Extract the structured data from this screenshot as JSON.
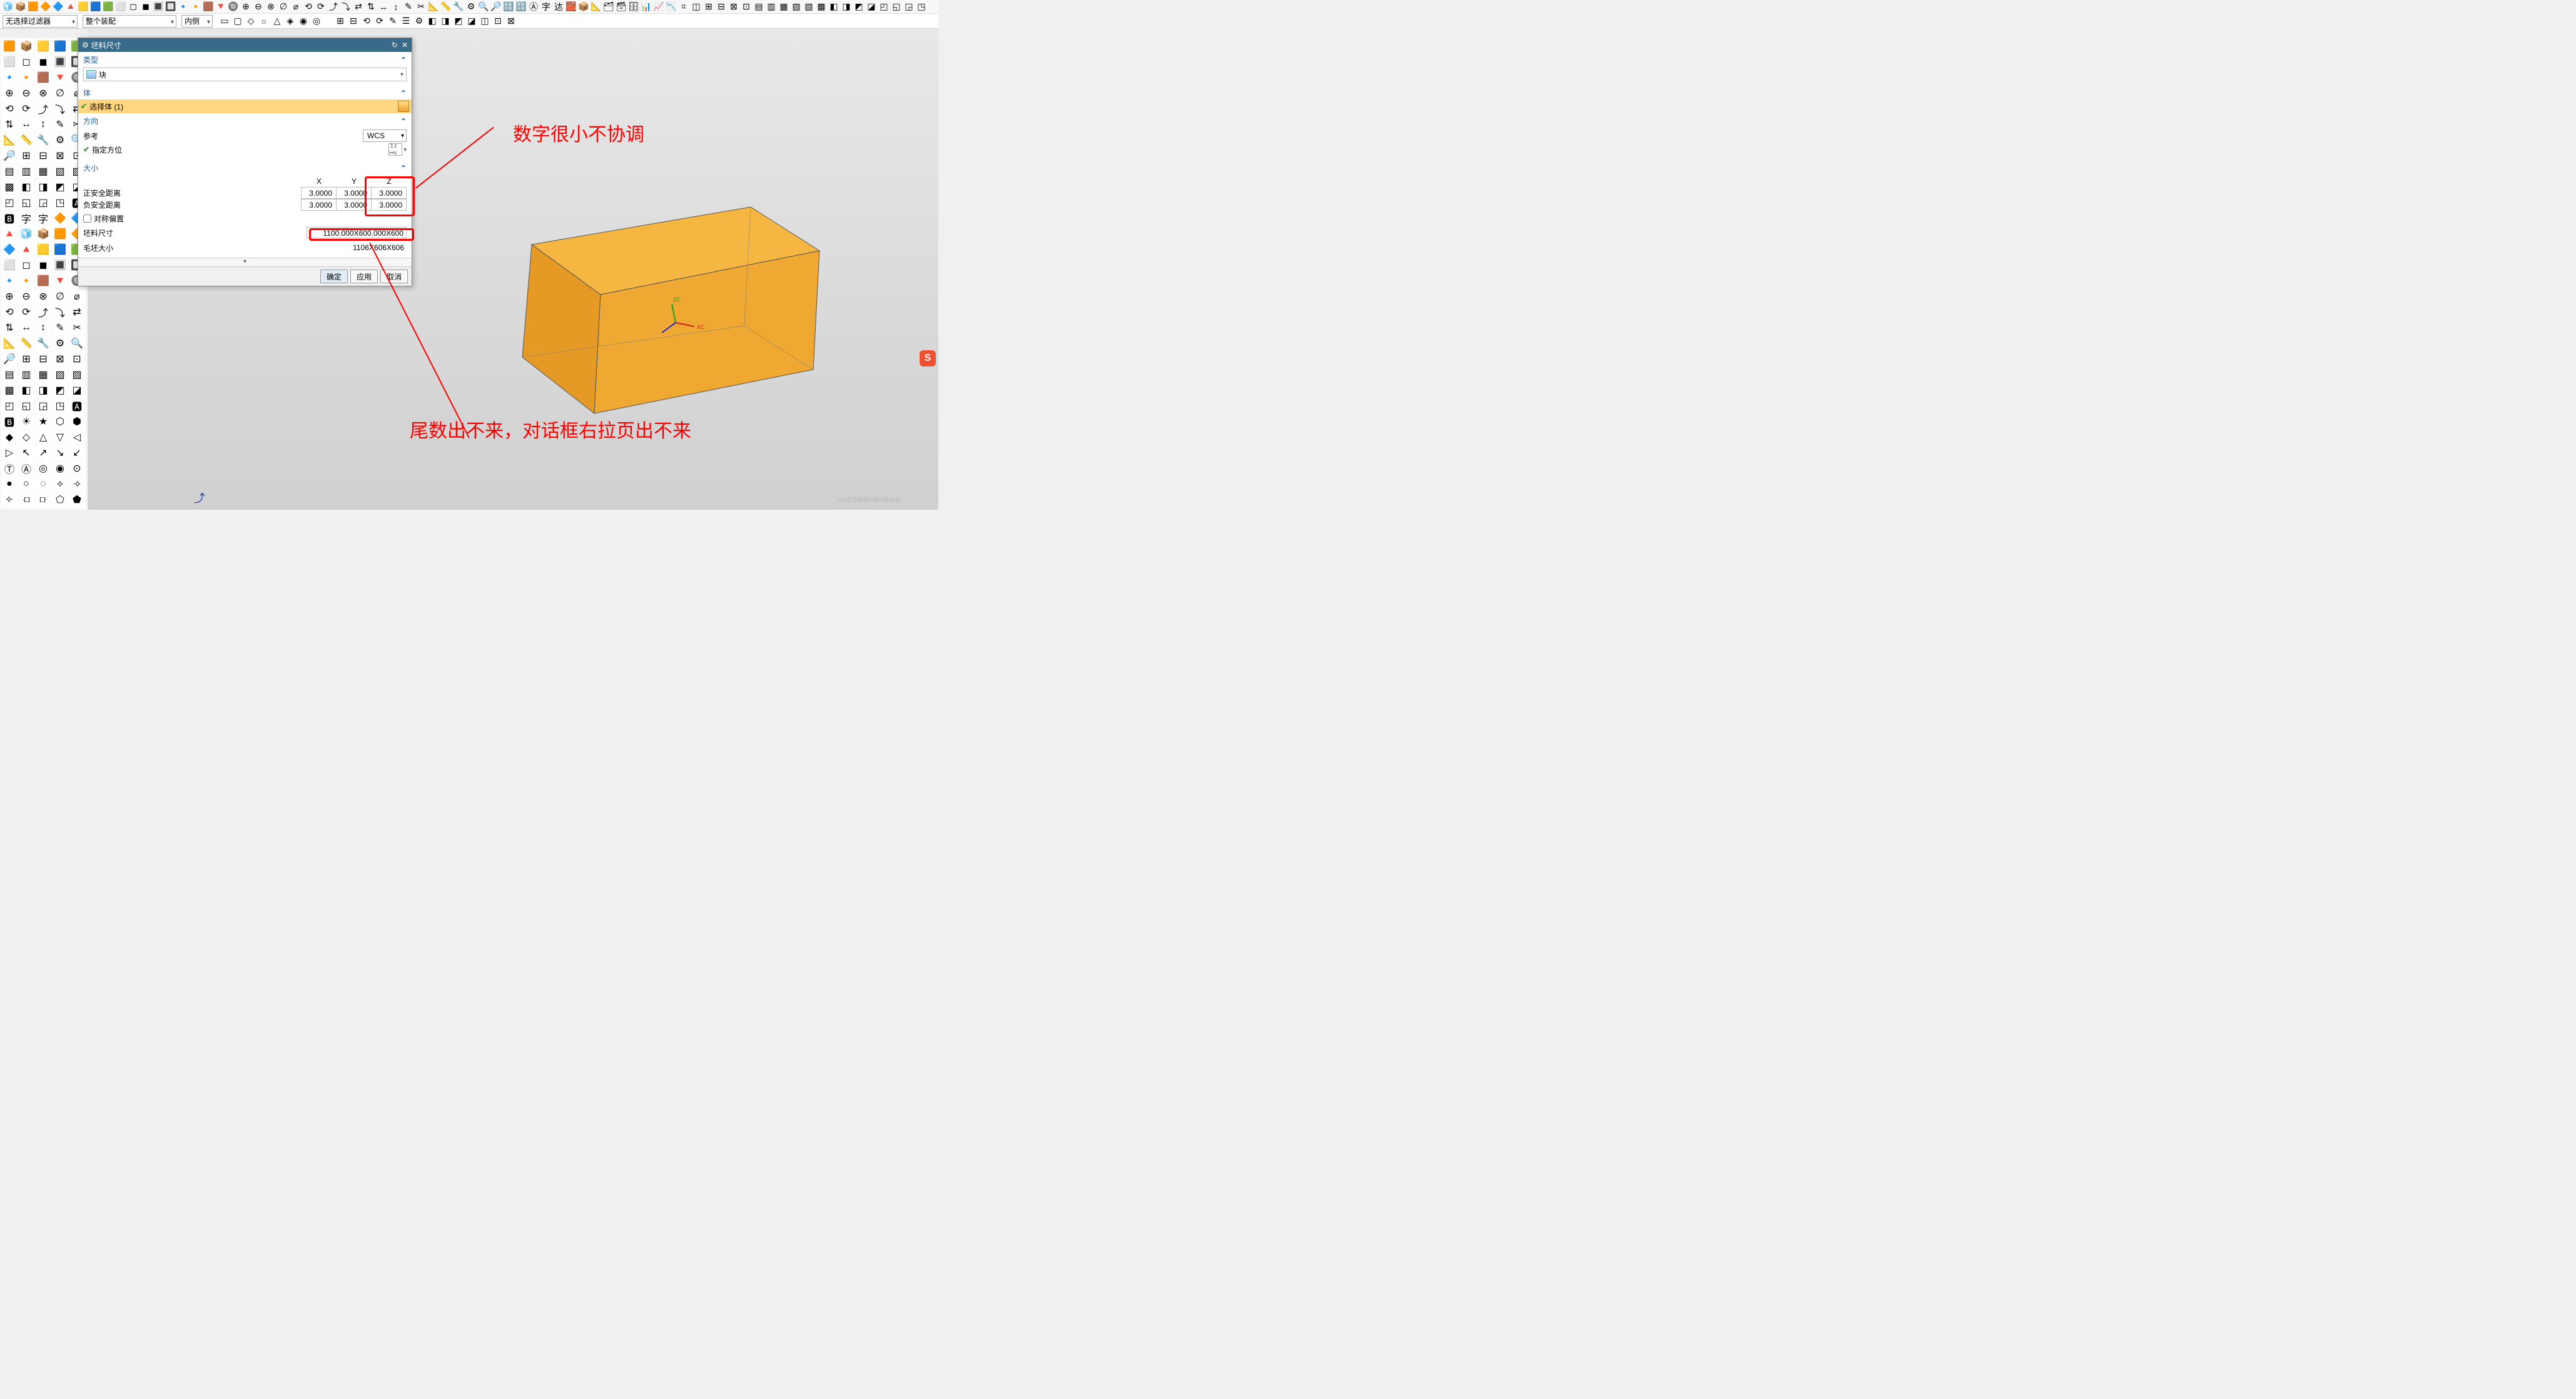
{
  "filter_row": {
    "no_selection_filter": "无选择过滤器",
    "whole_assembly": "整个装配",
    "inside": "内侧"
  },
  "dialog": {
    "title": "坯料尺寸",
    "sections": {
      "type": {
        "header": "类型",
        "value": "块"
      },
      "body": {
        "header": "体",
        "select_body": "选择体 (1)"
      },
      "direction": {
        "header": "方向",
        "reference_label": "参考",
        "reference_value": "WCS",
        "specify_label": "指定方位"
      },
      "size": {
        "header": "大小",
        "cols": [
          "X",
          "Y",
          "Z"
        ],
        "pos_safe_label": "正安全距离",
        "neg_safe_label": "负安全距离",
        "pos_values": [
          "3.0000",
          "3.0000",
          "3.0000"
        ],
        "neg_values": [
          "3.0000",
          "3.0000",
          "3.0000"
        ],
        "symmetric_offset": "对称偏置",
        "blank_dim_label": "坯料尺寸",
        "blank_dim_value": "1100.000X600.000X600",
        "raw_size_label": "毛坯大小",
        "raw_size_value": "1106X606X606"
      }
    },
    "buttons": {
      "ok": "确定",
      "apply": "应用",
      "cancel": "取消"
    }
  },
  "annotations": {
    "top_note": "数字很小不协调",
    "bottom_note": "尾数出不来，对话框右拉页出不来"
  },
  "sogou": "S",
  "watermark": "UG资源者低功耗©紫水晶",
  "top_icons": [
    "🧊",
    "📦",
    "🟧",
    "🔶",
    "🔷",
    "🔺",
    "🟨",
    "🟦",
    "🟩",
    "⬜",
    "◻",
    "◼",
    "🔳",
    "🔲",
    "🔹",
    "🔸",
    "🟫",
    "🔻",
    "🔘",
    "⊕",
    "⊖",
    "⊗",
    "∅",
    "⌀",
    "⟲",
    "⟳",
    "⤴",
    "⤵",
    "⇄",
    "⇅",
    "↔",
    "↕",
    "✎",
    "✂",
    "📐",
    "📏",
    "🔧",
    "⚙",
    "🔍",
    "🔎",
    "🔠",
    "🔡",
    "Ⓐ",
    "字",
    "迏",
    "🧱",
    "📦",
    "📐",
    "🗂",
    "🗃",
    "🗄",
    "📊",
    "📈",
    "📉",
    "⌗",
    "◫",
    "⊞",
    "⊟",
    "⊠",
    "⊡",
    "▤",
    "▥",
    "▦",
    "▧",
    "▨",
    "▩",
    "◧",
    "◨",
    "◩",
    "◪",
    "◰",
    "◱",
    "◲",
    "◳"
  ],
  "mini_icons_1": [
    "▭",
    "▢",
    "◇",
    "○",
    "△",
    "◈",
    "◉",
    "◎"
  ],
  "mini_icons_2": [
    "⊞",
    "⊟",
    "⟲",
    "⟳",
    "✎",
    "☰",
    "⚙",
    "◧",
    "◨",
    "◩",
    "◪",
    "◫",
    "⊡",
    "⊠"
  ],
  "palette_icons": [
    "🟧",
    "📦",
    "🟨",
    "🟦",
    "🟩",
    "⬜",
    "◻",
    "◼",
    "🔳",
    "🔲",
    "🔹",
    "🔸",
    "🟫",
    "🔻",
    "🔘",
    "⊕",
    "⊖",
    "⊗",
    "∅",
    "⌀",
    "⟲",
    "⟳",
    "⤴",
    "⤵",
    "⇄",
    "⇅",
    "↔",
    "↕",
    "✎",
    "✂",
    "📐",
    "📏",
    "🔧",
    "⚙",
    "🔍",
    "🔎",
    "⊞",
    "⊟",
    "⊠",
    "⊡",
    "▤",
    "▥",
    "▦",
    "▧",
    "▨",
    "▩",
    "◧",
    "◨",
    "◩",
    "◪",
    "◰",
    "◱",
    "◲",
    "◳",
    "🅰",
    "🅱",
    "字",
    "字",
    "🔶",
    "🔷",
    "🔺",
    "🧊",
    "📦",
    "🟧",
    "🔶",
    "🔷",
    "🔺",
    "🟨",
    "🟦",
    "🟩",
    "⬜",
    "◻",
    "◼",
    "🔳",
    "🔲",
    "🔹",
    "🔸",
    "🟫",
    "🔻",
    "🔘",
    "⊕",
    "⊖",
    "⊗",
    "∅",
    "⌀",
    "⟲",
    "⟳",
    "⤴",
    "⤵",
    "⇄",
    "⇅",
    "↔",
    "↕",
    "✎",
    "✂",
    "📐",
    "📏",
    "🔧",
    "⚙",
    "🔍",
    "🔎",
    "⊞",
    "⊟",
    "⊠",
    "⊡",
    "▤",
    "▥",
    "▦",
    "▧",
    "▨",
    "▩",
    "◧",
    "◨",
    "◩",
    "◪",
    "◰",
    "◱",
    "◲",
    "◳",
    "🅰",
    "🅱",
    "☀",
    "★",
    "⬡",
    "⬢",
    "◆",
    "◇",
    "△",
    "▽",
    "◁",
    "▷",
    "↖",
    "↗",
    "↘",
    "↙",
    "Ⓣ",
    "Ⓐ",
    "◎",
    "◉",
    "⊙",
    "●",
    "○",
    "◌",
    "⟡",
    "⟢",
    "⟣",
    "⟤",
    "⟥",
    "⬠",
    "⬟"
  ]
}
